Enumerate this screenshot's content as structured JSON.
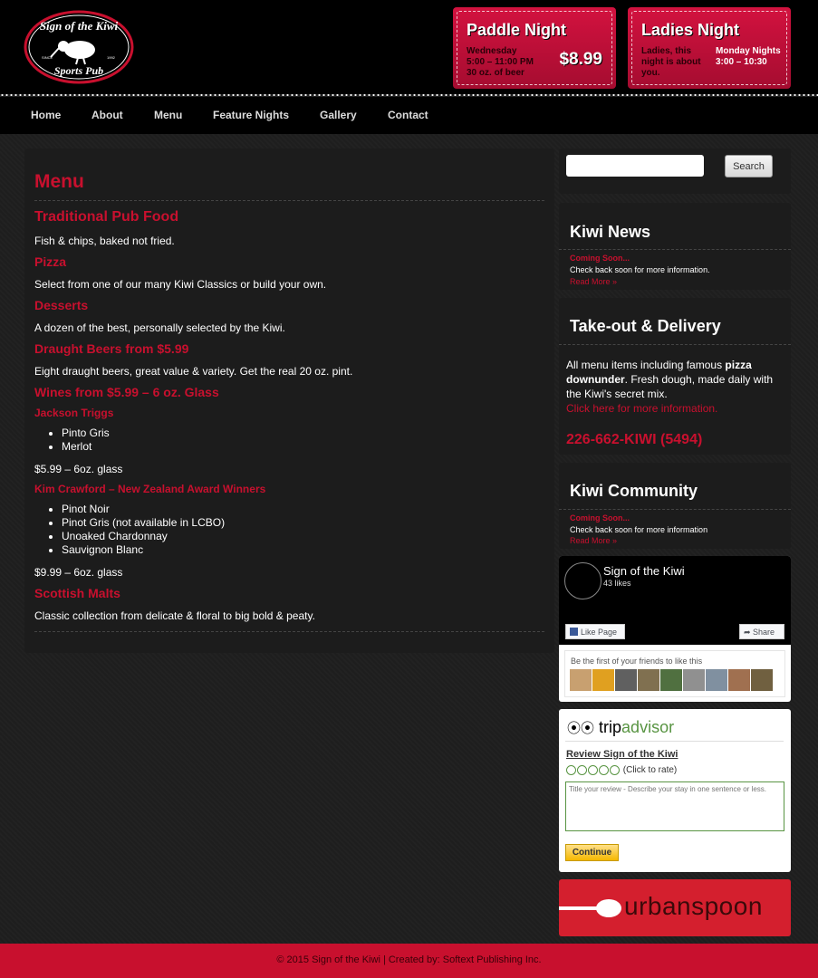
{
  "logo": {
    "top_text": "Sign of the Kiwi",
    "bottom_text": "Sports Pub",
    "since": "SINCE",
    "year": "1992"
  },
  "features": [
    {
      "title": "Paddle Night",
      "desc_lines": [
        "Wednesday",
        "5:00 – 11:00 PM",
        "30 oz. of beer"
      ],
      "price": "$8.99"
    },
    {
      "title": "Ladies Night",
      "desc_lines": [
        "Ladies, this",
        "night is about",
        "you."
      ],
      "side_lines": [
        "Monday Nights",
        "3:00 – 10:30"
      ]
    }
  ],
  "nav": [
    "Home",
    "About",
    "Menu",
    "Feature Nights",
    "Gallery",
    "Contact"
  ],
  "main": {
    "title": "Menu",
    "traditional_heading": "Traditional Pub Food",
    "traditional_text": "Fish & chips, baked not fried.",
    "pizza_heading": "Pizza",
    "pizza_text": "Select from one of our many Kiwi Classics or build your own.",
    "desserts_heading": "Desserts",
    "desserts_text": "A dozen of the best, personally selected by the Kiwi.",
    "draught_heading": "Draught Beers from $5.99",
    "draught_text": "Eight draught beers, great value & variety. Get the real 20 oz. pint.",
    "wines_heading": "Wines from $5.99 – 6 oz. Glass",
    "jackson_heading": "Jackson Triggs",
    "jackson_items": [
      "Pinto Gris",
      "Merlot"
    ],
    "jackson_price": "$5.99 – 6oz. glass",
    "kim_heading": "Kim Crawford – New Zealand Award Winners",
    "kim_items": [
      "Pinot Noir",
      "Pinot Gris (not available in LCBO)",
      "Unoaked Chardonnay",
      "Sauvignon Blanc"
    ],
    "kim_price": "$9.99 – 6oz. glass",
    "malts_heading": "Scottish Malts",
    "malts_text": "Classic collection from delicate & floral to big bold & peaty."
  },
  "search": {
    "placeholder": "",
    "button": "Search"
  },
  "news": {
    "title": "Kiwi News",
    "soon": "Coming Soon...",
    "text": "Check back soon for more information.",
    "more": "Read More »"
  },
  "takeout": {
    "title": "Take-out & Delivery",
    "text_before": "All menu items including famous ",
    "bold": "pizza downunder",
    "text_after": ". Fresh dough, made daily with the Kiwi's secret mix.",
    "link": "Click here for more information.",
    "phone": "226-662-KIWI (5494)"
  },
  "community": {
    "title": "Kiwi Community",
    "soon": "Coming Soon...",
    "text": "Check back soon for more information",
    "more": "Read More »"
  },
  "facebook": {
    "name": "Sign of the Kiwi",
    "likes": "43 likes",
    "like_btn": "Like Page",
    "share_btn": "Share",
    "friends_text": "Be the first of your friends to like this",
    "face_colors": [
      "#c8a070",
      "#e0a020",
      "#606060",
      "#807050",
      "#507040",
      "#909090",
      "#8090a0",
      "#a07050",
      "#706040"
    ]
  },
  "tripadvisor": {
    "logo_a": "trip",
    "logo_b": "advisor",
    "review_link": "Review Sign of the Kiwi",
    "rate_text": "(Click to rate)",
    "placeholder": "Title your review - Describe your stay in one sentence or less.",
    "continue": "Continue"
  },
  "urbanspoon": {
    "word": "urbanspoon"
  },
  "footer": {
    "text": "© 2015 Sign of the Kiwi | Created by: Softext Publishing Inc."
  },
  "colors": {
    "accent": "#c8102e",
    "background": "#1e1e1e",
    "header": "#000000"
  }
}
